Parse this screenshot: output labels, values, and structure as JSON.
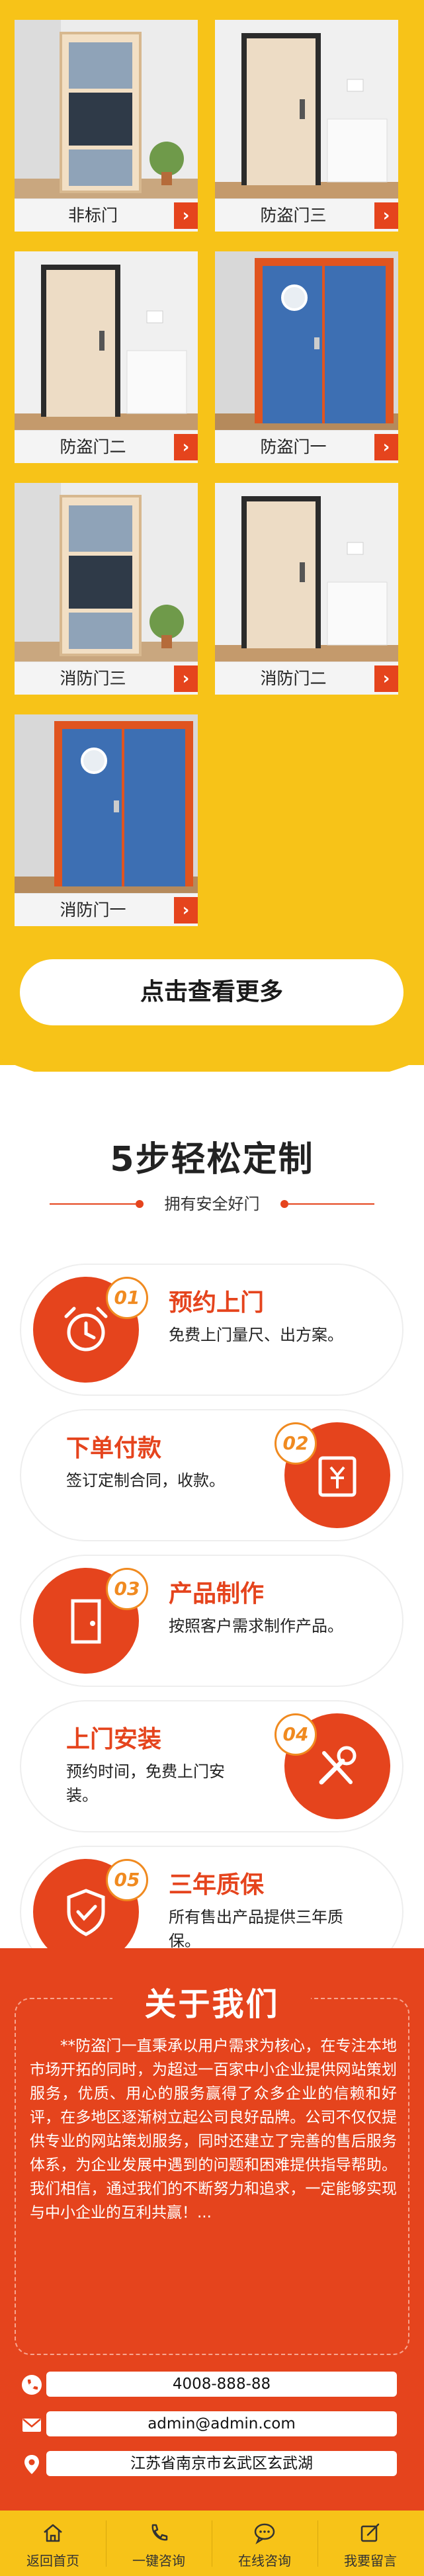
{
  "products": [
    {
      "name": "非标门",
      "arrow": "›",
      "style": "glass"
    },
    {
      "name": "防盗门三",
      "arrow": "›",
      "style": "beige"
    },
    {
      "name": "防盗门二",
      "arrow": "›",
      "style": "beige"
    },
    {
      "name": "防盗门一",
      "arrow": "›",
      "style": "blue"
    },
    {
      "name": "消防门三",
      "arrow": "›",
      "style": "glass"
    },
    {
      "name": "消防门二",
      "arrow": "›",
      "style": "beige"
    },
    {
      "name": "消防门一",
      "arrow": "›",
      "style": "blue"
    }
  ],
  "more_button": "点击查看更多",
  "steps_section": {
    "title": "5步轻松定制",
    "subtitle": "拥有安全好门",
    "steps": [
      {
        "num": "01",
        "title": "预约上门",
        "desc": "免费上门量尺、出方案。",
        "icon": "alarm-clock-icon"
      },
      {
        "num": "02",
        "title": "下单付款",
        "desc": "签订定制合同，收款。",
        "icon": "payment-icon"
      },
      {
        "num": "03",
        "title": "产品制作",
        "desc": "按照客户需求制作产品。",
        "icon": "door-icon"
      },
      {
        "num": "04",
        "title": "上门安装",
        "desc": "预约时间，免费上门安装。",
        "icon": "tools-icon"
      },
      {
        "num": "05",
        "title": "三年质保",
        "desc": "所有售出产品提供三年质保。",
        "icon": "shield-check-icon"
      }
    ]
  },
  "about": {
    "title": "关于我们",
    "text": "**防盗门一直秉承以用户需求为核心，在专注本地市场开拓的同时，为超过一百家中小企业提供网站策划服务，优质、用心的服务赢得了众多企业的信赖和好评，在多地区逐渐树立起公司良好品牌。公司不仅仅提供专业的网站策划服务，同时还建立了完善的售后服务体系，为企业发展中遇到的问题和困难提供指导帮助。我们相信，通过我们的不断努力和追求，一定能够实现与中小企业的互利共赢！..."
  },
  "contact": {
    "phone": "4008-888-88",
    "email": "admin@admin.com",
    "address": "江苏省南京市玄武区玄武湖"
  },
  "bottom_nav": [
    {
      "label": "返回首页",
      "icon": "home-icon"
    },
    {
      "label": "一键咨询",
      "icon": "phone-icon"
    },
    {
      "label": "在线咨询",
      "icon": "chat-icon"
    },
    {
      "label": "我要留言",
      "icon": "edit-icon"
    }
  ],
  "colors": {
    "yellow": "#f7c318",
    "orange_red": "#e5441d",
    "accent_orange": "#f08a20"
  }
}
